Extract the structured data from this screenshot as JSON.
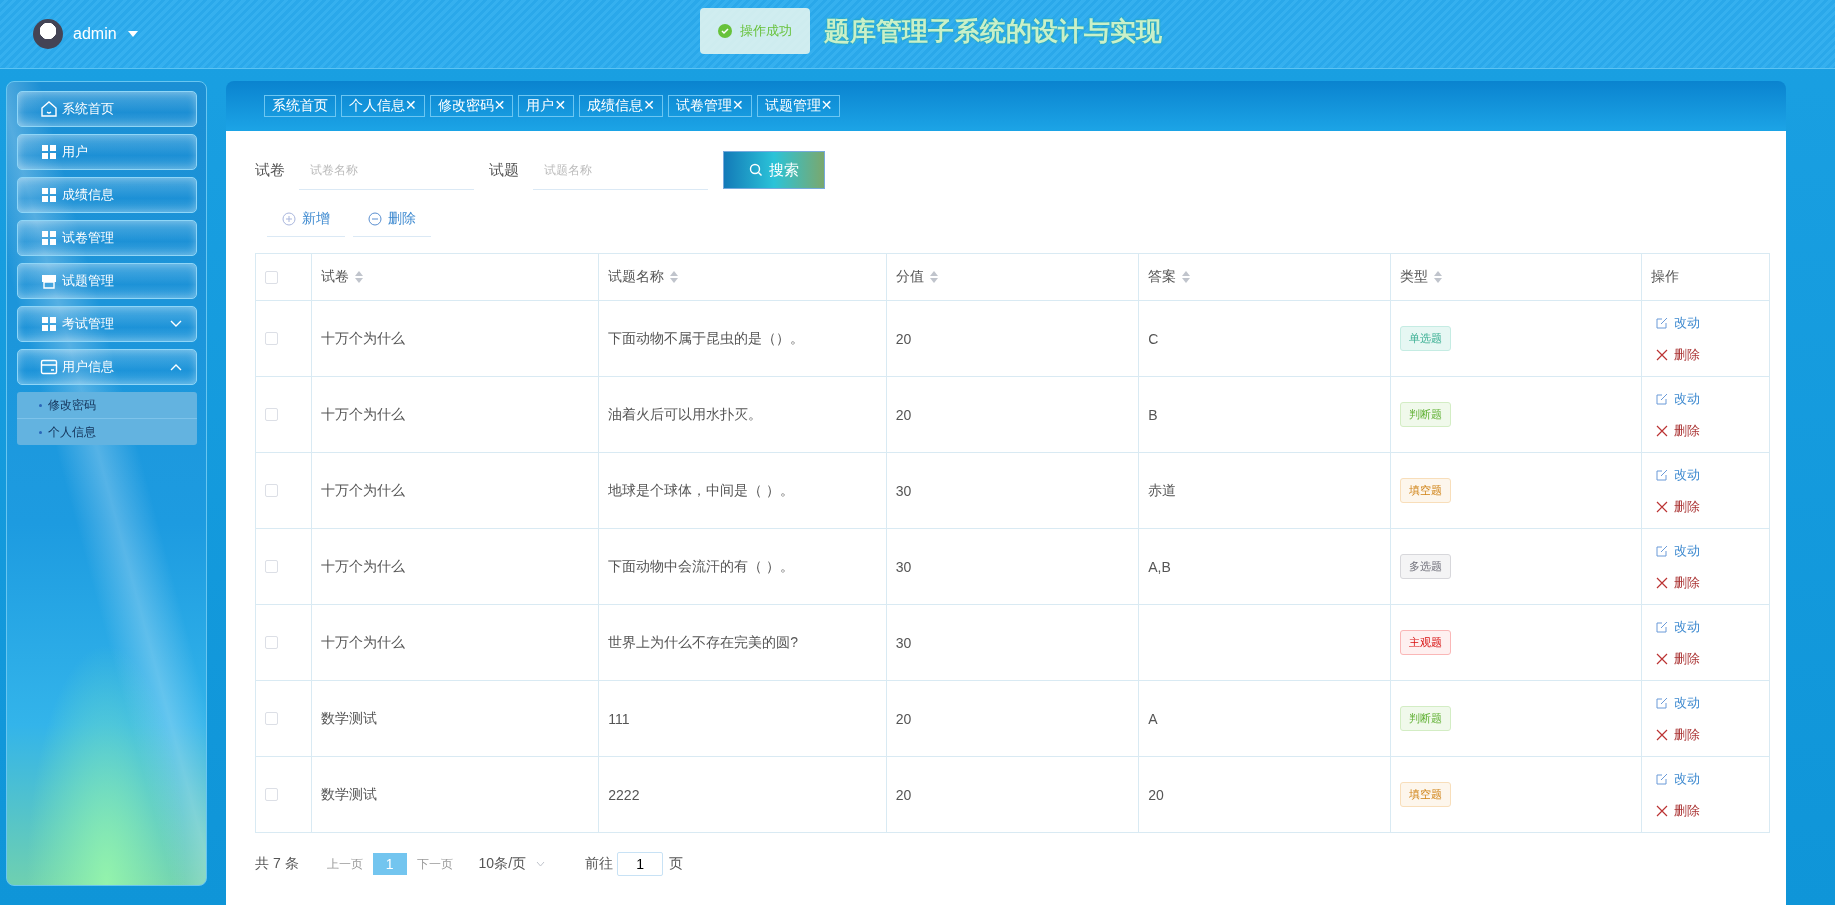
{
  "header": {
    "user": "admin",
    "title": "题库管理子系统的设计与实现",
    "toast": "操作成功"
  },
  "sidebar": {
    "items": [
      {
        "label": "系统首页",
        "kind": "home"
      },
      {
        "label": "用户",
        "kind": "grid"
      },
      {
        "label": "成绩信息",
        "kind": "grid"
      },
      {
        "label": "试卷管理",
        "kind": "grid"
      },
      {
        "label": "试题管理",
        "kind": "store"
      },
      {
        "label": "考试管理",
        "kind": "grid",
        "expanded": false
      },
      {
        "label": "用户信息",
        "kind": "card",
        "expanded": true,
        "children": [
          {
            "label": "修改密码"
          },
          {
            "label": "个人信息"
          }
        ]
      }
    ]
  },
  "tabs": [
    {
      "label": "系统首页"
    },
    {
      "label": "个人信息",
      "close": "✕"
    },
    {
      "label": "修改密码",
      "close": "✕"
    },
    {
      "label": "用户",
      "close": "✕"
    },
    {
      "label": "成绩信息",
      "close": "✕"
    },
    {
      "label": "试卷管理",
      "close": "✕"
    },
    {
      "label": "试题管理",
      "close": "✕"
    }
  ],
  "search": {
    "fields": [
      {
        "label": "试卷",
        "placeholder": "试卷名称"
      },
      {
        "label": "试题",
        "placeholder": "试题名称"
      }
    ],
    "button": "搜索"
  },
  "actions": [
    {
      "label": "新增",
      "kind": "add"
    },
    {
      "label": "删除",
      "kind": "remove"
    }
  ],
  "table": {
    "all_checked": false,
    "columns": [
      {
        "label": "试卷",
        "sortable": true
      },
      {
        "label": "试题名称",
        "sortable": true
      },
      {
        "label": "分值",
        "sortable": true
      },
      {
        "label": "答案",
        "sortable": true
      },
      {
        "label": "类型",
        "sortable": true
      },
      {
        "label": "操作",
        "sortable": false
      }
    ],
    "rows": [
      {
        "selected": false,
        "paper": "十万个为什么",
        "question": "下面动物不属于昆虫的是（）。",
        "score": "20",
        "answer": "C",
        "type": "单选题",
        "color": "#e6f7f3",
        "edit": "改动",
        "delete": "删除"
      },
      {
        "selected": false,
        "paper": "十万个为什么",
        "question": "油着火后可以用水扑灭。",
        "score": "20",
        "answer": "B",
        "type": "判断题",
        "color": "#f0f9eb",
        "edit": "改动",
        "delete": "删除"
      },
      {
        "selected": false,
        "paper": "十万个为什么",
        "question": "地球是个球体，中间是（ ）。",
        "score": "30",
        "answer": "赤道",
        "type": "填空题",
        "color": "#fdf6ec",
        "edit": "改动",
        "delete": "删除"
      },
      {
        "selected": false,
        "paper": "十万个为什么",
        "question": "下面动物中会流汗的有（ ）。",
        "score": "30",
        "answer": "A,B",
        "type": "多选题",
        "color": "#f4f4f5",
        "edit": "改动",
        "delete": "删除"
      },
      {
        "selected": false,
        "paper": "十万个为什么",
        "question": "世界上为什么不存在完美的圆?",
        "score": "30",
        "type": "主观题",
        "color": "#fef0f0",
        "edit": "改动",
        "delete": "删除"
      },
      {
        "selected": false,
        "paper": "数学测试",
        "question": "111",
        "score": "20",
        "answer": "A",
        "type": "判断题",
        "color": "#f0f9eb",
        "edit": "改动",
        "delete": "删除"
      },
      {
        "selected": false,
        "paper": "数学测试",
        "question": "2222",
        "score": "20",
        "answer": "20",
        "type": "填空题",
        "color": "#fdf6ec",
        "edit": "改动",
        "delete": "删除"
      }
    ]
  },
  "pagination": {
    "total": "共 7 条",
    "prev": "上一页",
    "pages": [
      {
        "label": "1",
        "selected": true
      }
    ],
    "next": "下一页",
    "page_size": "10条/页",
    "goto": "前往",
    "goto_value": "1",
    "goto_suffix": "页"
  }
}
